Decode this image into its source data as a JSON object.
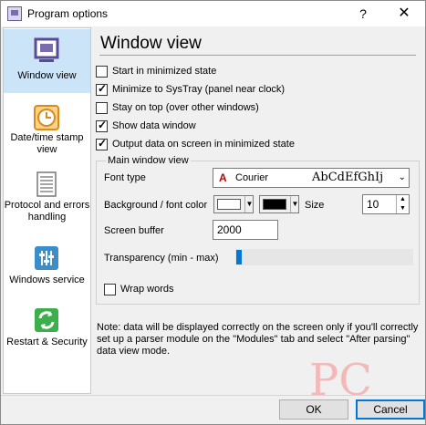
{
  "window": {
    "title": "Program options",
    "help_glyph": "?",
    "close_glyph": "✕"
  },
  "sidebar": {
    "items": [
      {
        "label": "Window view",
        "icon": "monitor-icon",
        "active": true
      },
      {
        "label": "Date/time stamp view",
        "icon": "clock-icon",
        "active": false
      },
      {
        "label": "Protocol and errors handling",
        "icon": "document-list-icon",
        "active": false
      },
      {
        "label": "Windows service",
        "icon": "sliders-icon",
        "active": false
      },
      {
        "label": "Restart & Security",
        "icon": "refresh-icon",
        "active": false
      }
    ]
  },
  "main": {
    "title": "Window view",
    "options": [
      {
        "label": "Start in minimized state",
        "checked": false
      },
      {
        "label": "Minimize to SysTray (panel near clock)",
        "checked": true
      },
      {
        "label": "Stay on top (over other windows)",
        "checked": false
      },
      {
        "label": "Show data window",
        "checked": true
      },
      {
        "label": "Output data on screen in minimized state",
        "checked": true
      }
    ],
    "group": {
      "title": "Main window view",
      "font_type_label": "Font type",
      "font_value": "Courier",
      "font_sample": "AbCdEfGhIj",
      "bg_font_color_label": "Background / font color",
      "bg_color": "#ffffff",
      "font_color": "#000000",
      "size_label": "Size",
      "size_value": "10",
      "screen_buffer_label": "Screen buffer",
      "screen_buffer_value": "2000",
      "transparency_label": "Transparency (min - max)",
      "transparency_value": 0,
      "wrap_words_label": "Wrap words",
      "wrap_words_checked": false
    },
    "note": "Note: data will be displayed correctly on the screen only if you'll correctly set up a parser module on the \"Modules\" tab and select \"After parsing\" data view mode."
  },
  "buttons": {
    "ok": "OK",
    "cancel": "Cancel"
  },
  "colors": {
    "accent": "#0078d7",
    "active_nav": "#cce4f7"
  }
}
